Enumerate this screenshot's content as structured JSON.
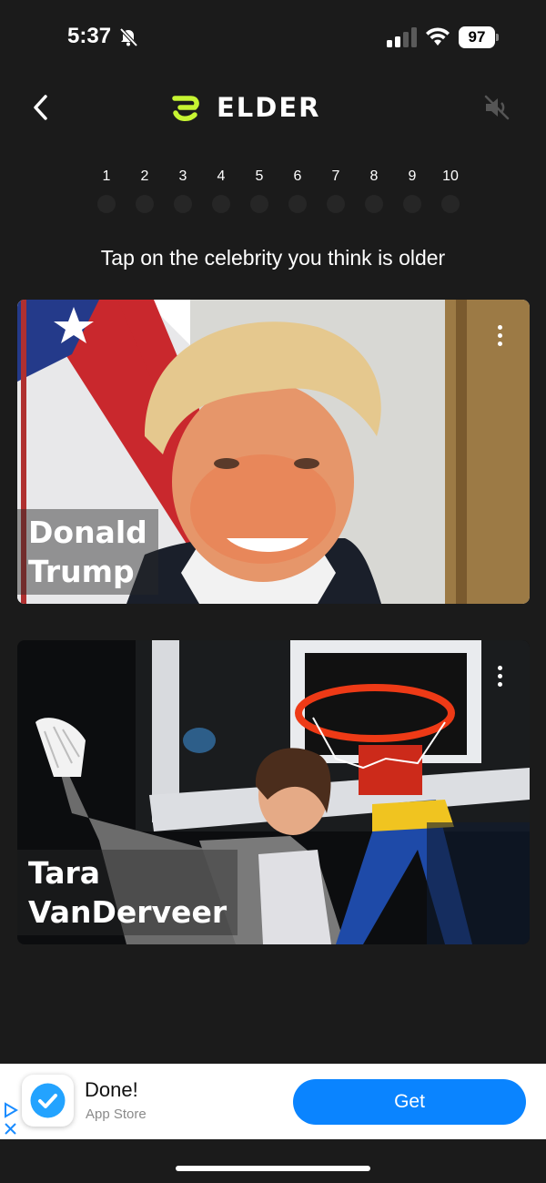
{
  "status_bar": {
    "time": "5:37",
    "battery": "97",
    "icons": [
      "bell-slash-icon",
      "signal-icon",
      "wifi-icon",
      "battery-icon"
    ]
  },
  "header": {
    "logo_text": "ELDER",
    "back_icon": "chevron-left-icon",
    "mute_icon": "speaker-muted-icon"
  },
  "progress": {
    "steps": [
      "1",
      "2",
      "3",
      "4",
      "5",
      "6",
      "7",
      "8",
      "9",
      "10"
    ],
    "current": 0
  },
  "instruction": "Tap on the celebrity you think is older",
  "cards": [
    {
      "name_line1": "Donald",
      "name_line2": "Trump"
    },
    {
      "name_line1": "Tara",
      "name_line2": "VanDerveer"
    }
  ],
  "ad": {
    "title": "Done!",
    "subtitle": "App Store",
    "button_label": "Get"
  },
  "colors": {
    "background": "#1b1b1b",
    "logo_accent": "#c6f432",
    "ad_button": "#0a84ff"
  }
}
